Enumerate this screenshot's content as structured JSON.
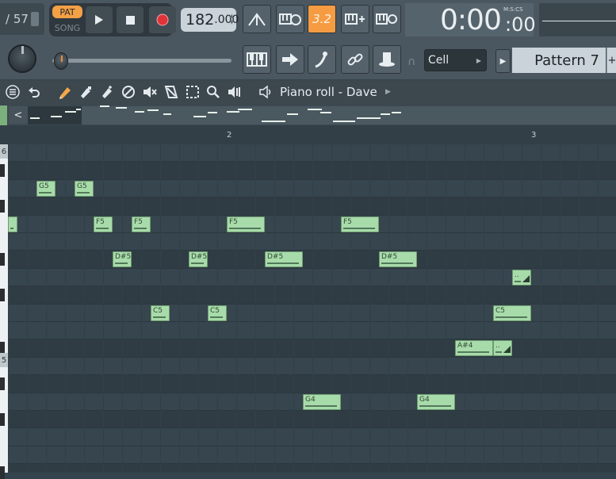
{
  "toolbar": {
    "counter": "/ 57",
    "pat_label": "PAT",
    "song_label": "SONG",
    "tempo_main": "182",
    "tempo_decimal": ".000",
    "snap_label": "3.2",
    "time_main": "0:00",
    "time_cs": ":00",
    "time_format": "M:S:CS",
    "snap_mode": "Cell",
    "pattern_name": "Pattern 7",
    "pattern_add": "+"
  },
  "piano_roll": {
    "title": "Piano roll - Dave",
    "ruler_markers": [
      "2",
      "3"
    ],
    "octave_labels": [
      "6",
      "5"
    ]
  },
  "notes": [
    {
      "label": "G5",
      "pitch": "G5"
    },
    {
      "label": "G5",
      "pitch": "G5"
    },
    {
      "label": "",
      "pitch": "F5"
    },
    {
      "label": "F5",
      "pitch": "F5"
    },
    {
      "label": "F5",
      "pitch": "F5"
    },
    {
      "label": "F5",
      "pitch": "F5"
    },
    {
      "label": "F5",
      "pitch": "F5"
    },
    {
      "label": "D#5",
      "pitch": "D#5"
    },
    {
      "label": "D#5",
      "pitch": "D#5"
    },
    {
      "label": "D#5",
      "pitch": "D#5"
    },
    {
      "label": "D#5",
      "pitch": "D#5"
    },
    {
      "label": "..",
      "pitch": "D5"
    },
    {
      "label": "C5",
      "pitch": "C5"
    },
    {
      "label": "C5",
      "pitch": "C5"
    },
    {
      "label": "C5",
      "pitch": "C5"
    },
    {
      "label": "A#4",
      "pitch": "A#4"
    },
    {
      "label": "..",
      "pitch": "A#4"
    },
    {
      "label": "G4",
      "pitch": "G4"
    },
    {
      "label": "G4",
      "pitch": "G4"
    }
  ],
  "colors": {
    "note_fill": "#a8dbaa",
    "accent_orange": "#f3a046",
    "record_red": "#e0343a"
  }
}
